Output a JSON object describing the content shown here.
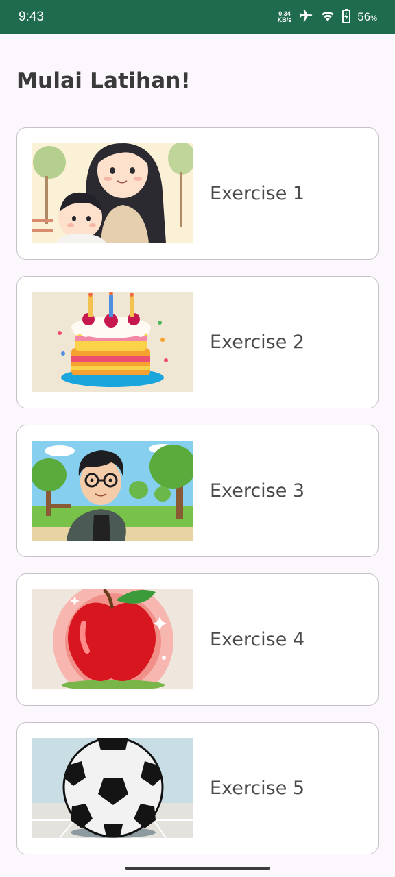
{
  "status_bar": {
    "time": "9:43",
    "net_speed_value": "0.34",
    "net_speed_unit": "KB/s",
    "battery_percent": "56",
    "battery_unit": "%",
    "icons": [
      "airplane-mode-icon",
      "wifi-icon",
      "battery-charging-icon"
    ]
  },
  "page": {
    "title": "Mulai Latihan!"
  },
  "exercises": [
    {
      "label": "Exercise 1",
      "image": "mother-and-baby-illustration"
    },
    {
      "label": "Exercise 2",
      "image": "birthday-cake-illustration"
    },
    {
      "label": "Exercise 3",
      "image": "man-in-park-illustration"
    },
    {
      "label": "Exercise 4",
      "image": "red-apple-illustration"
    },
    {
      "label": "Exercise 5",
      "image": "soccer-ball-illustration"
    }
  ],
  "colors": {
    "status_bar": "#1f6b4e",
    "background": "#fcf7fc",
    "card_border": "#c7c2c9",
    "title_text": "#3a3a3a"
  }
}
